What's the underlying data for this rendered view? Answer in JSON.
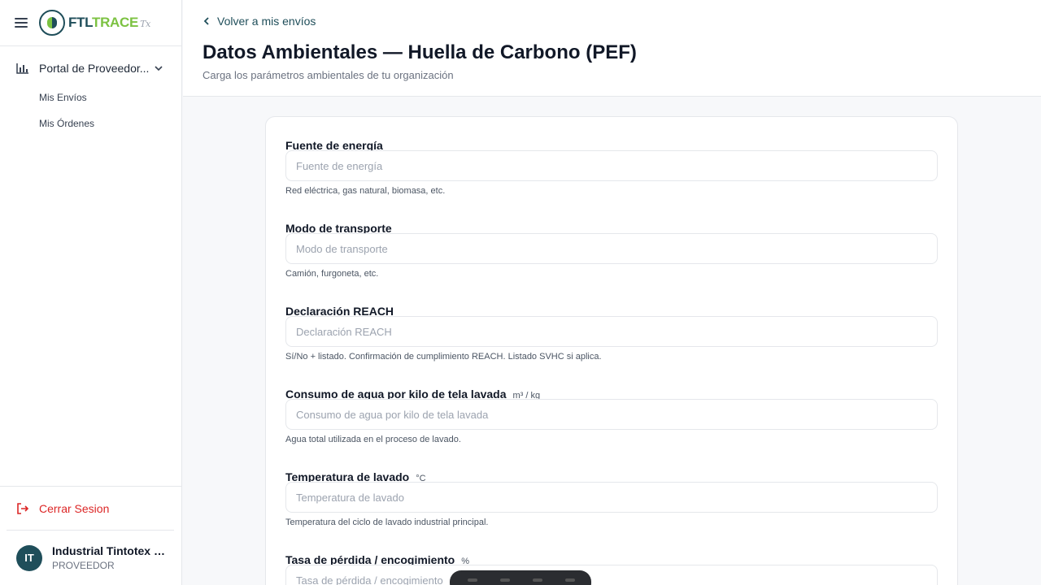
{
  "brand": {
    "name_part1": "FTL",
    "name_part2": "TRACE",
    "suffix": "Tx",
    "primary_color": "#1f4e5a",
    "accent_color": "#7cc242"
  },
  "sidebar": {
    "group": {
      "label": "Portal de Proveedor...",
      "icon": "chart-icon"
    },
    "items": [
      {
        "label": "Mis Envíos"
      },
      {
        "label": "Mis Órdenes"
      }
    ],
    "logout_label": "Cerrar Sesion",
    "user": {
      "initials": "IT",
      "name": "Industrial Tintotex S...",
      "role": "PROVEEDOR"
    }
  },
  "header": {
    "back_label": "Volver a mis envíos",
    "title": "Datos Ambientales — Huella de Carbono (PEF)",
    "subtitle": "Carga los parámetros ambientales de tu organización"
  },
  "form": {
    "fields": [
      {
        "label": "Fuente de energía",
        "unit": "",
        "placeholder": "Fuente de energía",
        "value": "",
        "help": "Red eléctrica, gas natural, biomasa, etc."
      },
      {
        "label": "Modo de transporte",
        "unit": "",
        "placeholder": "Modo de transporte",
        "value": "",
        "help": "Camión, furgoneta, etc."
      },
      {
        "label": "Declaración REACH",
        "unit": "",
        "placeholder": "Declaración REACH",
        "value": "",
        "help": "Sí/No + listado. Confirmación de cumplimiento REACH. Listado SVHC si aplica."
      },
      {
        "label": "Consumo de agua por kilo de tela lavada",
        "unit": "m³ / kg",
        "placeholder": "Consumo de agua por kilo de tela lavada",
        "value": "",
        "help": "Agua total utilizada en el proceso de lavado."
      },
      {
        "label": "Temperatura de lavado",
        "unit": "°C",
        "placeholder": "Temperatura de lavado",
        "value": "",
        "help": "Temperatura del ciclo de lavado industrial principal."
      },
      {
        "label": "Tasa de pérdida / encogimiento",
        "unit": "%",
        "placeholder": "Tasa de pérdida / encogimiento",
        "value": "",
        "help": ""
      }
    ]
  }
}
